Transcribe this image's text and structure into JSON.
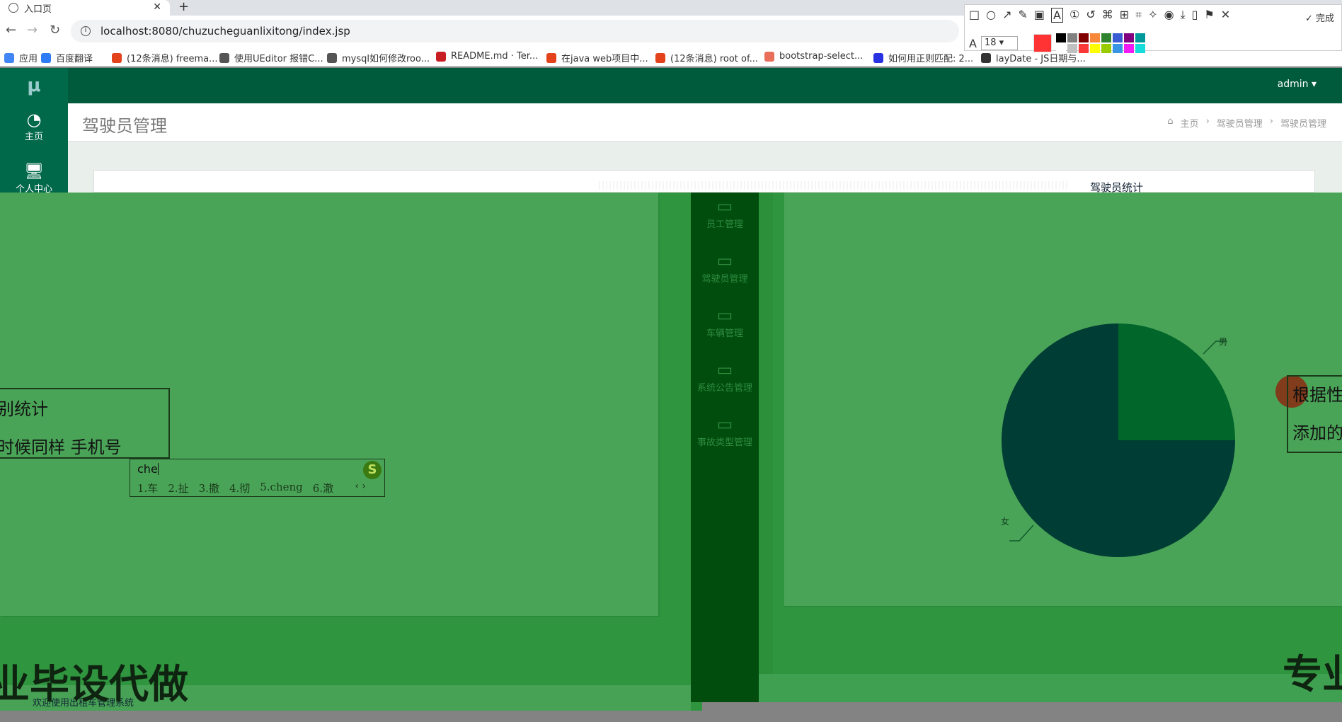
{
  "browser": {
    "tab_title": "入口页",
    "url": "localhost:8080/chuzucheguanlixitong/index.jsp",
    "bookmarks": [
      {
        "label": "应用",
        "icon": "apps-icon",
        "color": "#4285f4"
      },
      {
        "label": "百度翻译",
        "icon": "baidu-translate-icon",
        "color": "#2e7bf6"
      },
      {
        "label": "(12条消息) freema...",
        "icon": "csdn-icon",
        "color": "#e3421b"
      },
      {
        "label": "使用UEditor 报错C...",
        "icon": "bookmark-logo-icon",
        "color": "#555555"
      },
      {
        "label": "mysql如何修改roo...",
        "icon": "bookmark-logo-icon",
        "color": "#555555"
      },
      {
        "label": "README.md · Ter...",
        "icon": "gitee-icon",
        "color": "#c71d23"
      },
      {
        "label": "在java web项目中...",
        "icon": "csdn-icon",
        "color": "#e3421b"
      },
      {
        "label": "(12条消息) root of...",
        "icon": "csdn-icon",
        "color": "#e3421b"
      },
      {
        "label": "bootstrap-select...",
        "icon": "jianshu-icon",
        "color": "#ea6f5a"
      },
      {
        "label": "如何用正则匹配: 2...",
        "icon": "baidu-paw-icon",
        "color": "#2932e1"
      },
      {
        "label": "layDate - JS日期与...",
        "icon": "layui-icon",
        "color": "#333333"
      }
    ]
  },
  "snip_tool": {
    "done_label": "完成",
    "font_size": "18",
    "current_color": "#ff3333",
    "swatches": [
      "#000000",
      "#808080",
      "#800000",
      "#f7883a",
      "#308430",
      "#385ad3",
      "#800080",
      "#009999",
      "#ffffff",
      "#c0c0c0",
      "#fb3838",
      "#ffff00",
      "#99cc00",
      "#3894e4",
      "#f31bf3",
      "#16dcdc"
    ]
  },
  "app": {
    "logo": "μ",
    "user": "admin",
    "sidebar": [
      {
        "label": "主页",
        "icon": "dashboard-icon"
      },
      {
        "label": "个人中心",
        "icon": "monitor-icon"
      }
    ],
    "page_title": "驾驶员管理",
    "breadcrumb": [
      "主页",
      "驾驶员管理",
      "驾驶员管理"
    ]
  },
  "overlay": {
    "sidebar": [
      {
        "label": "员工管理",
        "icon": "monitor-icon"
      },
      {
        "label": "驾驶员管理",
        "icon": "monitor-icon"
      },
      {
        "label": "车辆管理",
        "icon": "monitor-icon"
      },
      {
        "label": "系统公告管理",
        "icon": "monitor-icon"
      },
      {
        "label": "事故类型管理",
        "icon": "monitor-icon"
      }
    ],
    "note_left": {
      "line1": "别统计",
      "line2": "时候同样  手机号"
    },
    "note_right": {
      "line1": "根据性",
      "line2": "添加的"
    },
    "ime": {
      "typed": "che",
      "candidates": [
        "1.车",
        "2.扯",
        "3.撤",
        "4.彻",
        "5.cheng",
        "6.澈"
      ],
      "logo": "S"
    },
    "big_left": "业毕设代做",
    "big_right": "专业",
    "footer": "欢迎使用出租车管理系统",
    "pie_title": "驾驶员统计"
  },
  "chart_data": {
    "type": "pie",
    "title": "驾驶员统计",
    "categories": [
      "男",
      "女"
    ],
    "values": [
      25,
      75
    ],
    "colors": [
      "#00662a",
      "#003d34"
    ]
  }
}
